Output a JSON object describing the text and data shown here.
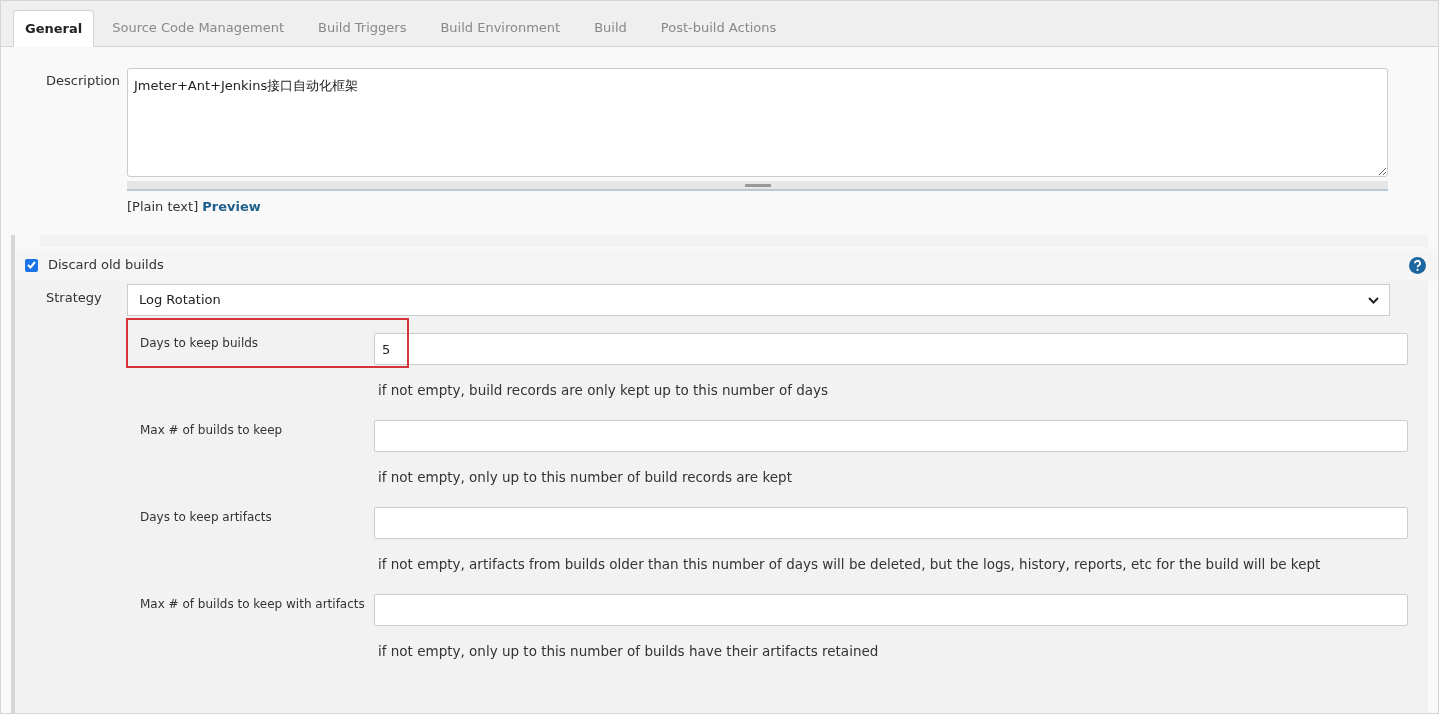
{
  "tabs": [
    {
      "label": "General",
      "selected": true
    },
    {
      "label": "Source Code Management",
      "selected": false
    },
    {
      "label": "Build Triggers",
      "selected": false
    },
    {
      "label": "Build Environment",
      "selected": false
    },
    {
      "label": "Build",
      "selected": false
    },
    {
      "label": "Post-build Actions",
      "selected": false
    }
  ],
  "description": {
    "label": "Description",
    "value": "Jmeter+Ant+Jenkins接口自动化框架",
    "format": "[Plain text]",
    "preview_link": "Preview"
  },
  "discard_old_builds": {
    "label": "Discard old builds",
    "checked": true
  },
  "strategy": {
    "label": "Strategy",
    "value": "Log Rotation"
  },
  "fields": [
    {
      "label": "Days to keep builds",
      "value": "5",
      "help": "if not empty, build records are only kept up to this number of days",
      "highlighted": true
    },
    {
      "label": "Max # of builds to keep",
      "help": "if not empty, only up to this number of build records are kept",
      "highlighted": false
    },
    {
      "label": "Days to keep artifacts",
      "help": "if not empty, artifacts from builds older than this number of days will be deleted, but the logs, history, reports, etc for the build will be kept",
      "highlighted": false
    },
    {
      "label": "Max # of builds to keep with artifacts",
      "help": "if not empty, only up to this number of builds have their artifacts retained",
      "highlighted": false
    }
  ]
}
